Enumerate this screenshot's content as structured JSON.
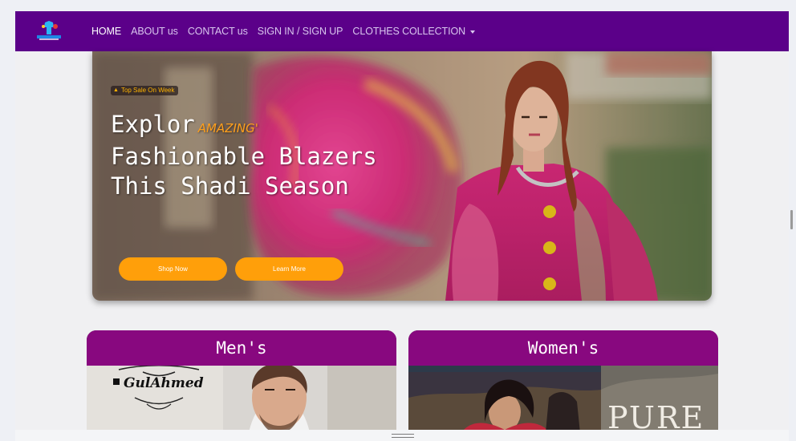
{
  "nav": {
    "items": [
      {
        "label": "HOME",
        "active": true
      },
      {
        "label": "ABOUT us"
      },
      {
        "label": "CONTACT us"
      },
      {
        "label": "SIGN IN / SIGN UP"
      },
      {
        "label": "CLOTHES COLLECTION",
        "dropdown": true
      }
    ]
  },
  "hero": {
    "badge": "Top Sale On Week",
    "line1": "Explor",
    "amazing": "AMAZING'",
    "line2": "Fashionable Blazers",
    "line3": "This Shadi Season",
    "shop_button": "Shop Now",
    "learn_button": "Learn More"
  },
  "cards": {
    "men": {
      "title": "Men's",
      "brand": "GulAhmed"
    },
    "women": {
      "title": "Women's",
      "brand": "PURE"
    }
  },
  "colors": {
    "navbar": "#5b0089",
    "card_header": "#88087f",
    "accent": "#ff9f0a"
  }
}
